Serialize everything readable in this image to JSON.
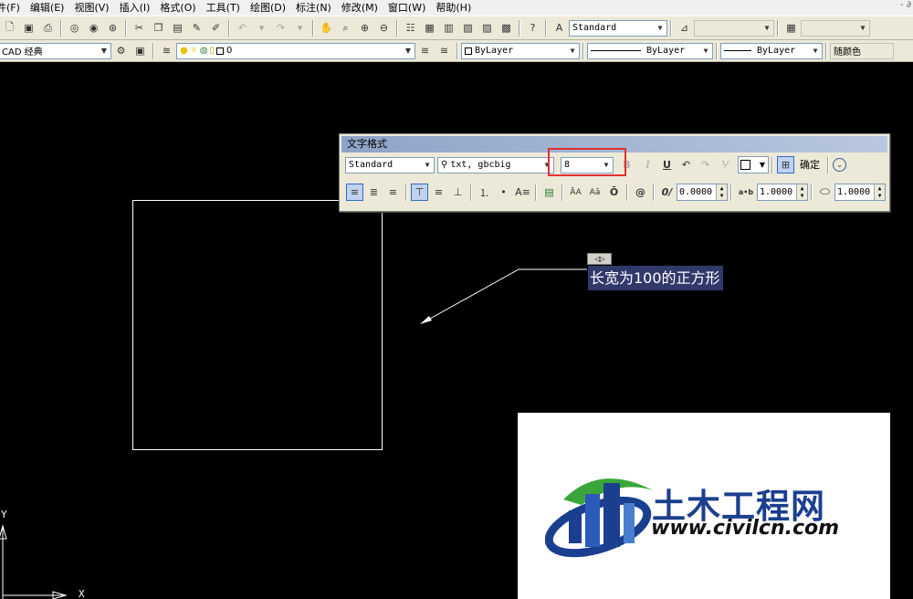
{
  "menu": [
    "件(F)",
    "编辑(E)",
    "视图(V)",
    "插入(I)",
    "格式(O)",
    "工具(T)",
    "绘图(D)",
    "标注(N)",
    "修改(M)",
    "窗口(W)",
    "帮助(H)"
  ],
  "window_ctl": "- ∂",
  "styles_toolbar": {
    "text_style": "Standard",
    "dim_style": "",
    "table_style": ""
  },
  "layers_toolbar": {
    "workspace": "CAD 经典",
    "layer": "0",
    "color": "ByLayer",
    "linetype": "ByLayer",
    "lineweight": "ByLayer",
    "plot_style": "随颜色"
  },
  "text_format": {
    "title": "文字格式",
    "style": "Standard",
    "font": "txt, gbcbig",
    "height": "8",
    "bold": "B",
    "italic": "I",
    "underline": "U",
    "ok_label": "确定",
    "oblique": "0.0000",
    "tracking": "1.0000",
    "width_factor": "1.0000",
    "row2_icons": {
      "upper": "ĀA",
      "lower": "Aā",
      "overline": "Ō",
      "symbol": "@",
      "oblique": "0/",
      "tracking": "a•b"
    }
  },
  "mtext": {
    "ruler": "◁▷",
    "content": "长宽为100的正方形"
  },
  "ucs": {
    "y": "Y",
    "x": "X"
  },
  "logo": {
    "cn": "土木工程网",
    "url": "www.civilcn.com"
  },
  "colors": {
    "accent_blue": "#1b3f8f",
    "logo_green": "#3aa63a",
    "highlight_red": "#e03030",
    "mtext_bg": "#31396b"
  }
}
